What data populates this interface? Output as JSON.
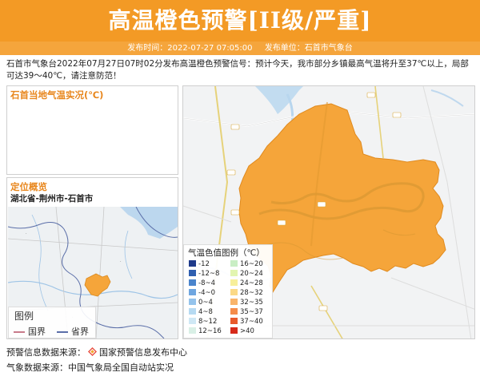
{
  "header": {
    "title": "高温橙色预警[II级/严重]",
    "publish_time": "发布时间：2022-07-27 07:05:00",
    "publisher": "发布单位：石首市气象台"
  },
  "description": "石首市气象台2022年07月27日07时02分发布高温橙色预警信号：预计今天，我市部分乡镇最高气温将升至37℃以上，局部可达39～40℃，请注意防范！",
  "temp_panel": {
    "title": "石首当地气温实况(℃)"
  },
  "location_panel": {
    "title": "定位概览",
    "path": "湖北省-荆州市-石首市"
  },
  "small_legend": {
    "title": "图例",
    "items": [
      {
        "label": "国界",
        "color": "#c87a8a"
      },
      {
        "label": "省界",
        "color": "#5a6ea8"
      }
    ]
  },
  "temp_legend": {
    "title": "气温色值图例（℃）",
    "items": [
      {
        "label": "-12",
        "color": "#1e3a8a"
      },
      {
        "label": "-12~8",
        "color": "#2f5fb0"
      },
      {
        "label": "-8~4",
        "color": "#4a84cc"
      },
      {
        "label": "-4~0",
        "color": "#6fa6e0"
      },
      {
        "label": "0~4",
        "color": "#94c3ec"
      },
      {
        "label": "4~8",
        "color": "#b6daf2"
      },
      {
        "label": "8~12",
        "color": "#cfe8f5"
      },
      {
        "label": "12~16",
        "color": "#d9f0e6"
      },
      {
        "label": "16~20",
        "color": "#c9eec4"
      },
      {
        "label": "20~24",
        "color": "#e2f5b0"
      },
      {
        "label": "24~28",
        "color": "#f7ef9a"
      },
      {
        "label": "28~32",
        "color": "#fbd986"
      },
      {
        "label": "32~35",
        "color": "#f9b46a"
      },
      {
        "label": "35~37",
        "color": "#f58c4a"
      },
      {
        "label": "37~40",
        "color": "#e85a2c"
      },
      {
        "label": ">40",
        "color": "#d62a1a"
      }
    ]
  },
  "footer": {
    "warn_source_label": "预警信息数据来源：",
    "warn_source_name": "国家预警信息发布中心",
    "weather_source": "气象数据来源：中国气象局全国自动站实况"
  },
  "colors": {
    "brand_orange": "#f39a25",
    "region_fill": "#f5a53a"
  }
}
